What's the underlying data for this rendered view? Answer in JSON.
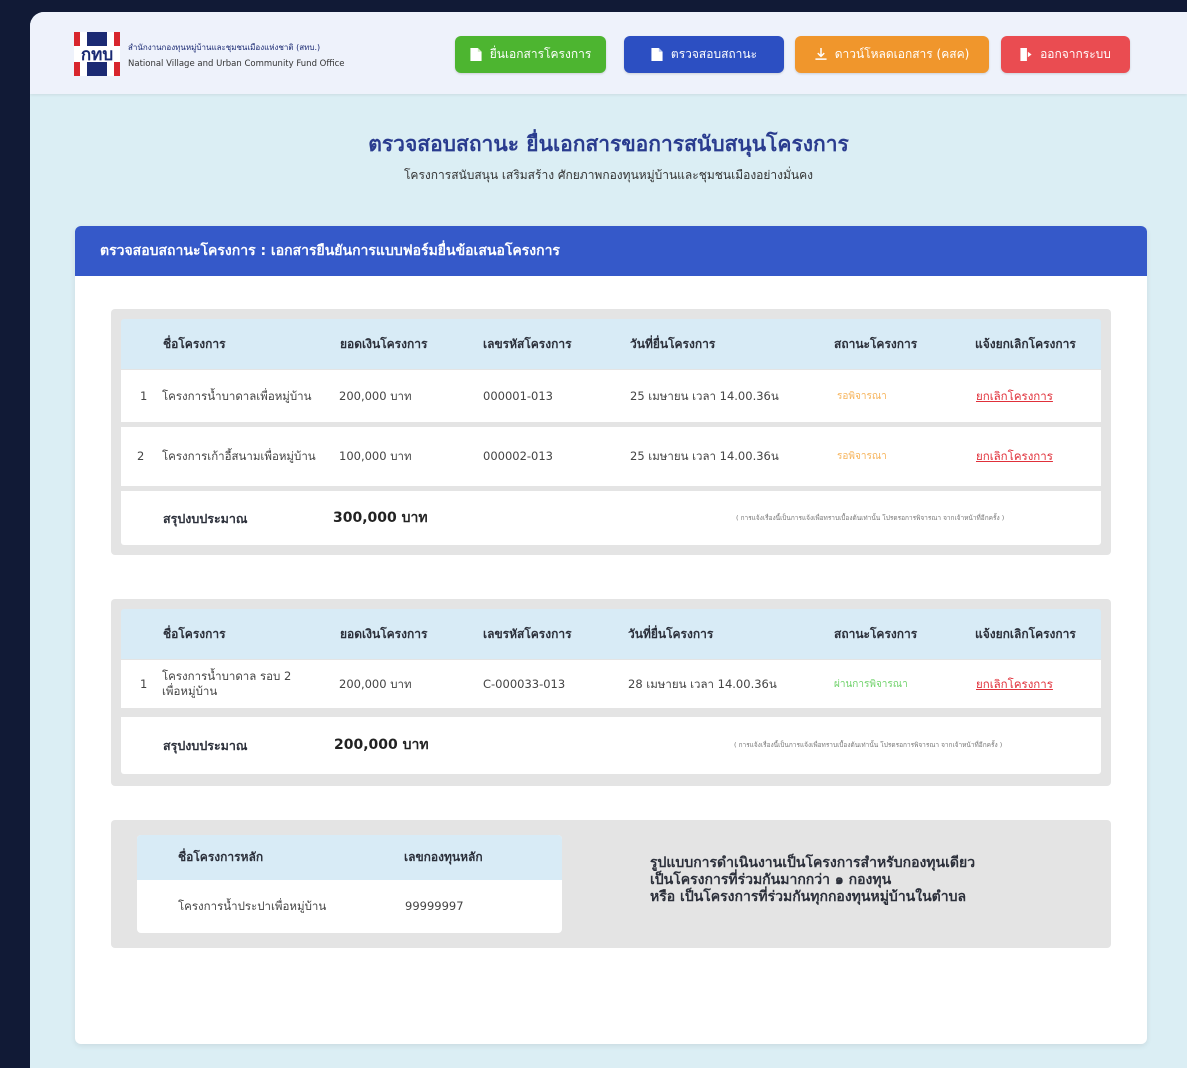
{
  "header": {
    "logo_text": "กทบ",
    "org_name_th": "สำนักงานกองทุนหมู่บ้านและชุมชนเมืองแห่งชาติ (สทบ.)",
    "org_name_en": "National Village and Urban Community Fund Office",
    "nav": {
      "submit": "ยื่นเอกสารโครงการ",
      "check_status": "ตรวจสอบสถานะ",
      "download": "ดาวน์โหลดเอกสาร (คสค)",
      "logout": "ออกจากระบบ"
    },
    "colors": {
      "green": "#4db530",
      "blue": "#2c4fc2",
      "orange": "#f0962c",
      "red": "#ea4c51"
    }
  },
  "page": {
    "title": "ตรวจสอบสถานะ ยื่นเอกสารขอการสนับสนุนโครงการ",
    "subtitle": "โครงการสนับสนุน เสริมสร้าง ศักยภาพกองทุนหมู่บ้านและชุมชนเมืองอย่างมั่นคง"
  },
  "card": {
    "header": "ตรวจสอบสถานะโครงการ  : เอกสารยืนยันการแบบฟอร์มยื่นข้อเสนอโครงการ"
  },
  "columns": {
    "name": "ชื่อโครงการ",
    "amount": "ยอดเงินโครงการ",
    "code": "เลขรหัสโครงการ",
    "date": "วันที่ยื่นโครงการ",
    "status": "สถานะโครงการ",
    "cancel": "แจ้งยกเลิกโครงการ"
  },
  "table1": {
    "rows": [
      {
        "no": "1",
        "name": "โครงการน้ำบาดาลเพื่อหมู่บ้าน",
        "amount": "200,000 บาท",
        "code": "000001-013",
        "date": "25 เมษายน เวลา 14.00.36น",
        "status": "รอพิจารณา",
        "cancel": "ยกเลิกโครงการ"
      },
      {
        "no": "2",
        "name": "โครงการเก้าอี้สนามเพื่อหมู่บ้าน",
        "amount": "100,000 บาท",
        "code": "000002-013",
        "date": "25 เมษายน เวลา 14.00.36น",
        "status": "รอพิจารณา",
        "cancel": "ยกเลิกโครงการ"
      }
    ],
    "summary_label": "สรุปงบประมาณ",
    "summary_value": "300,000 บาท",
    "note": "( การแจ้งเรื่องนี้เป็นการแจ้งเพื่อทราบเบื้องต้นเท่านั้น โปรดรอการพิจารณา จากเจ้าหน้าที่อีกครั้ง )"
  },
  "table2": {
    "rows": [
      {
        "no": "1",
        "name": "โครงการน้ำบาดาล รอบ 2 เพื่อหมู่บ้าน",
        "amount": "200,000 บาท",
        "code": "C-000033-013",
        "date": "28 เมษายน เวลา 14.00.36น",
        "status": "ผ่านการพิจารณา",
        "cancel": "ยกเลิกโครงการ"
      }
    ],
    "summary_label": "สรุปงบประมาณ",
    "summary_value": "200,000 บาท",
    "note": "( การแจ้งเรื่องนี้เป็นการแจ้งเพื่อทราบเบื้องต้นเท่านั้น โปรดรอการพิจารณา จากเจ้าหน้าที่อีกครั้ง )"
  },
  "main_project": {
    "col_name": "ชื่อโครงการหลัก",
    "col_fund": "เลขกองทุนหลัก",
    "name": "โครงการน้ำประปาเพื่อหมู่บ้าน",
    "fund": "99999997",
    "info_lines": [
      "รูปแบบการดำเนินงานเป็นโครงการสำหรับกองทุนเดียว",
      "เป็นโครงการที่ร่วมกันมากกว่า ๑ กองทุน",
      "หรือ เป็นโครงการที่ร่วมกันทุกกองทุนหมู่บ้านในตำบล"
    ]
  }
}
